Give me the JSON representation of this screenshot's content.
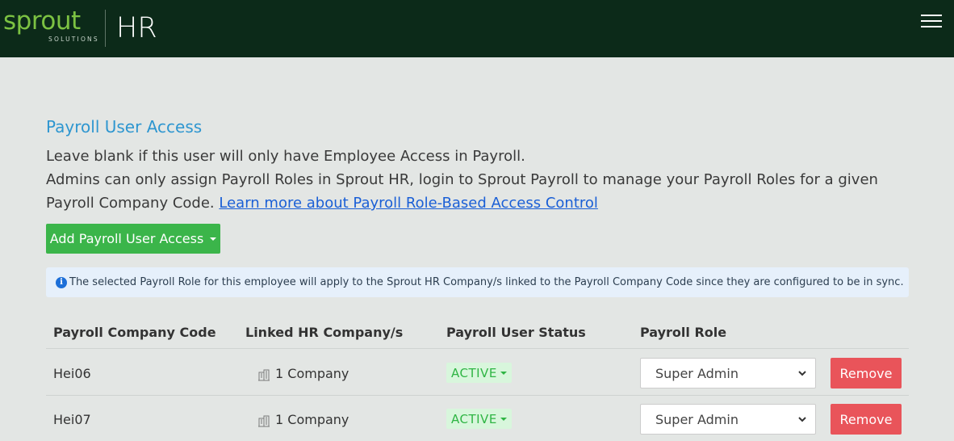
{
  "header": {
    "logo_word": "sprout",
    "logo_sub": "SOLUTIONS",
    "logo_hr": "HR",
    "menu_icon": "hamburger-icon"
  },
  "section": {
    "title": "Payroll User Access",
    "line1": "Leave blank if this user will only have Employee Access in Payroll.",
    "line2": "Admins can only assign Payroll Roles in Sprout HR, login to Sprout Payroll to manage your Payroll Roles for a given Payroll Company Code.",
    "link": "Learn more about Payroll Role-Based Access Control",
    "add_button": "Add Payroll User Access"
  },
  "info": {
    "icon": "info-icon",
    "text": "The selected Payroll Role for this employee will apply to the Sprout HR Company/s linked to the Payroll Company Code since they are configured to be in sync."
  },
  "table": {
    "headers": [
      "Payroll Company Code",
      "Linked HR Company/s",
      "Payroll User Status",
      "Payroll Role"
    ],
    "rows": [
      {
        "code": "Hei06",
        "company": "1 Company",
        "status": "ACTIVE",
        "role": "Super Admin",
        "action": "Remove"
      },
      {
        "code": "Hei07",
        "company": "1 Company",
        "status": "ACTIVE",
        "role": "Super Admin",
        "action": "Remove"
      }
    ]
  },
  "colors": {
    "topbar": "#0c2a19",
    "brand_green": "#7cc242",
    "title_blue": "#2e96d0",
    "add_button": "#3bb54a",
    "remove_button": "#e9545a",
    "active_badge_bg": "#d8f6dc",
    "active_badge_text": "#2fb544"
  }
}
